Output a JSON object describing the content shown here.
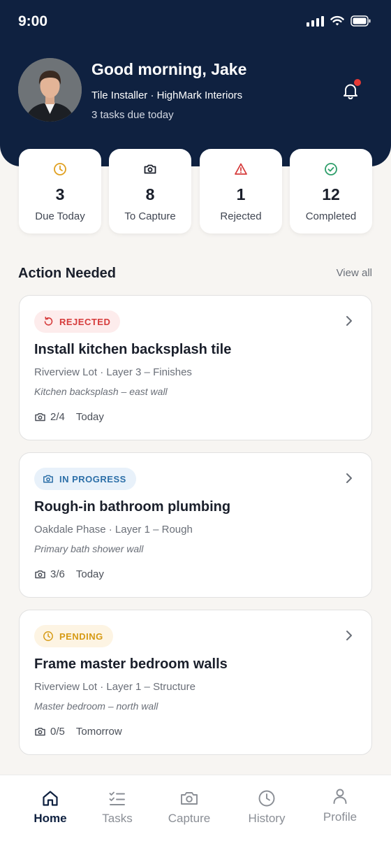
{
  "status_bar": {
    "time": "9:00"
  },
  "header": {
    "greeting": "Good morning, Jake",
    "role": "Tile Installer · HighMark Interiors",
    "tasks_due": "3 tasks due today",
    "has_notification": true,
    "colors": {
      "background": "#0f2140",
      "notification_dot": "#e53935"
    }
  },
  "stats": [
    {
      "value": "3",
      "label": "Due Today",
      "icon": "clock-icon",
      "color": "#e0a020"
    },
    {
      "value": "8",
      "label": "To Capture",
      "icon": "camera-icon",
      "color": "#1a1f2b"
    },
    {
      "value": "1",
      "label": "Rejected",
      "icon": "warning-icon",
      "color": "#d63b3b"
    },
    {
      "value": "12",
      "label": "Completed",
      "icon": "check-circle-icon",
      "color": "#2e9e6a"
    }
  ],
  "section": {
    "title": "Action Needed",
    "view_all": "View all"
  },
  "tasks": [
    {
      "status": "REJECTED",
      "status_icon": "undo-icon",
      "status_color": "#d63b3b",
      "status_bg": "#fdecec",
      "title": "Install kitchen backsplash tile",
      "meta": "Riverview Lot  · Layer 3 – Finishes",
      "location": "Kitchen backsplash – east wall",
      "photos": "2/4",
      "due": "Today"
    },
    {
      "status": "IN PROGRESS",
      "status_icon": "camera-icon",
      "status_color": "#2c6fa8",
      "status_bg": "#e8f1fa",
      "title": "Rough-in bathroom plumbing",
      "meta": "Oakdale Phase · Layer 1 – Rough",
      "location": "Primary bath shower wall",
      "photos": "3/6",
      "due": "Today"
    },
    {
      "status": "PENDING",
      "status_icon": "clock-icon",
      "status_color": "#d69a14",
      "status_bg": "#fdf4e3",
      "title": "Frame master bedroom walls",
      "meta": "Riverview Lot  · Layer 1 – Structure",
      "location": "Master bedroom – north wall",
      "photos": "0/5",
      "due": "Tomorrow"
    }
  ],
  "tabbar": {
    "items": [
      {
        "label": "Home",
        "icon": "home-icon",
        "active": true
      },
      {
        "label": "Tasks",
        "icon": "checklist-icon",
        "active": false
      },
      {
        "label": "Capture",
        "icon": "camera-icon",
        "active": false
      },
      {
        "label": "History",
        "icon": "clock-icon",
        "active": false
      },
      {
        "label": "Profile",
        "icon": "person-icon",
        "active": false
      }
    ]
  }
}
